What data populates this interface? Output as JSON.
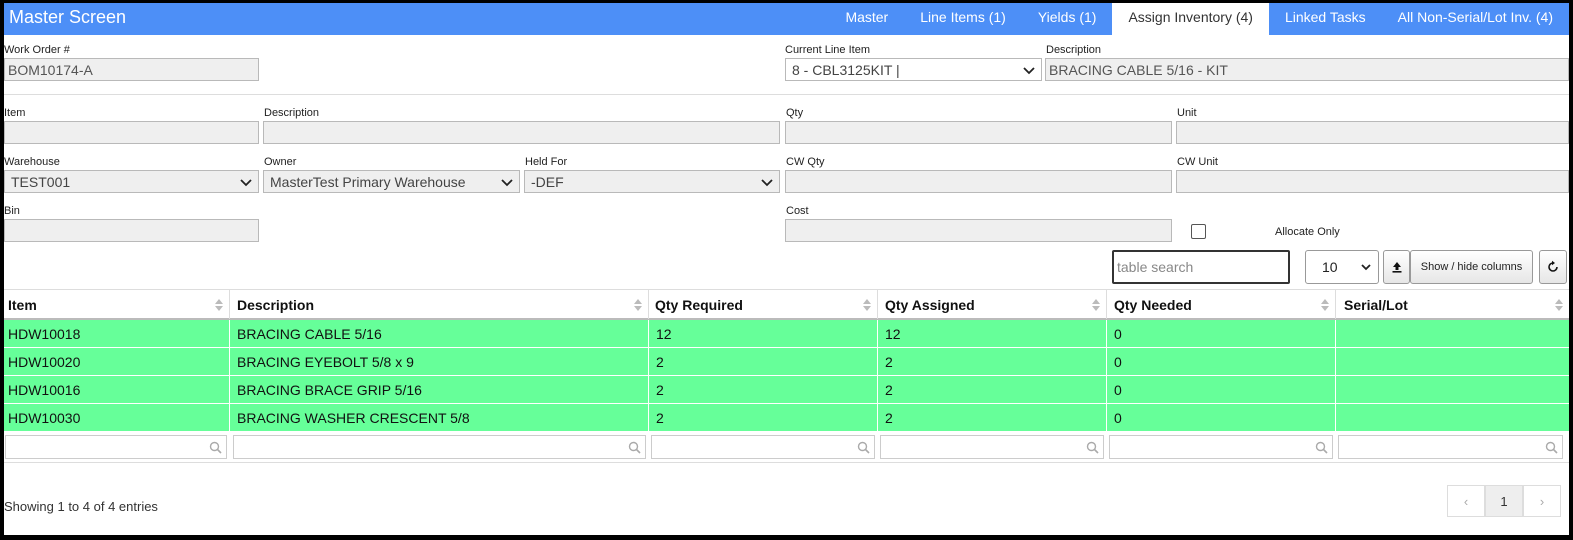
{
  "header": {
    "title": "Master Screen",
    "tabs": [
      {
        "label": "Master"
      },
      {
        "label": "Line Items (1)"
      },
      {
        "label": "Yields (1)"
      },
      {
        "label": "Assign Inventory (4)"
      },
      {
        "label": "Linked Tasks"
      },
      {
        "label": "All Non-Serial/Lot Inv. (4)"
      }
    ],
    "active_tab": "Assign Inventory (4)"
  },
  "work_order": {
    "label": "Work Order #",
    "value": "BOM10174-A"
  },
  "current_line_item": {
    "label": "Current Line Item",
    "value": "8 - CBL3125KIT |"
  },
  "line_description": {
    "label": "Description",
    "value": "BRACING CABLE  5/16 - KIT"
  },
  "form": {
    "item": {
      "label": "Item",
      "value": ""
    },
    "description": {
      "label": "Description",
      "value": ""
    },
    "qty": {
      "label": "Qty",
      "value": ""
    },
    "unit": {
      "label": "Unit",
      "value": ""
    },
    "warehouse": {
      "label": "Warehouse",
      "value": "TEST001"
    },
    "owner": {
      "label": "Owner",
      "value": "MasterTest Primary Warehouse"
    },
    "held_for": {
      "label": "Held For",
      "value": "-DEF"
    },
    "cw_qty": {
      "label": "CW Qty",
      "value": ""
    },
    "cw_unit": {
      "label": "CW Unit",
      "value": ""
    },
    "bin": {
      "label": "Bin",
      "value": ""
    },
    "cost": {
      "label": "Cost",
      "value": ""
    },
    "allocate_only": {
      "label": "Allocate Only",
      "checked": false
    }
  },
  "toolbar": {
    "search_placeholder": "table search",
    "page_length": "10",
    "show_hide_label": "Show / hide columns",
    "export_icon": "upload-icon",
    "reset_icon": "refresh-icon"
  },
  "table": {
    "columns": [
      "Item",
      "Description",
      "Qty Required",
      "Qty Assigned",
      "Qty Needed",
      "Serial/Lot"
    ],
    "rows": [
      [
        "HDW10018",
        "BRACING CABLE 5/16",
        "12",
        "12",
        "0",
        ""
      ],
      [
        "HDW10020",
        "BRACING EYEBOLT 5/8 x 9",
        "2",
        "2",
        "0",
        ""
      ],
      [
        "HDW10016",
        "BRACING BRACE GRIP 5/16",
        "2",
        "2",
        "0",
        ""
      ],
      [
        "HDW10030",
        "BRACING WASHER CRESCENT 5/8",
        "2",
        "2",
        "0",
        ""
      ]
    ],
    "row_color": "#66ff99"
  },
  "footer": {
    "info": "Showing 1 to 4 of 4 entries",
    "pagination": {
      "prev": "‹",
      "current": "1",
      "next": "›"
    }
  },
  "colors": {
    "header": "#4d8ff7",
    "row": "#66ff99"
  }
}
